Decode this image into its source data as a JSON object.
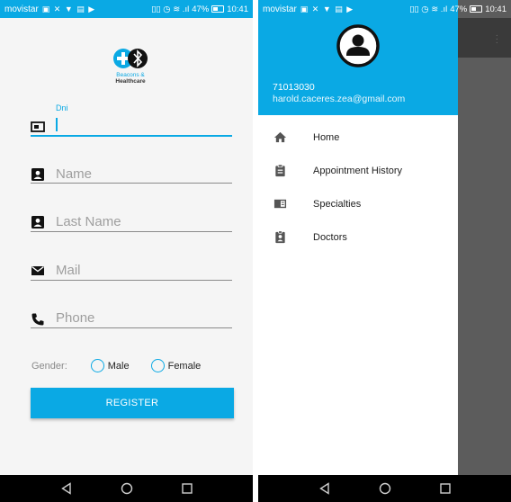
{
  "status_bar": {
    "carrier": "movistar",
    "left_icons": "▣ ✕ ▼ ▤ ▶",
    "right_icons": "▯▯ ◷ ≋ .ıl",
    "battery": "47%",
    "time_left": "10:41",
    "time_right": "10:41"
  },
  "form": {
    "logo_line1": "Beacons &",
    "logo_line2": "Healthcare",
    "dni_label": "Dni",
    "name_placeholder": "Name",
    "last_name_placeholder": "Last Name",
    "mail_placeholder": "Mail",
    "phone_placeholder": "Phone",
    "gender_label": "Gender:",
    "male_label": "Male",
    "female_label": "Female",
    "register_label": "REGISTER"
  },
  "drawer": {
    "user_id": "71013030",
    "user_email": "harold.caceres.zea@gmail.com",
    "items": [
      {
        "label": "Home",
        "icon": "home-icon"
      },
      {
        "label": "Appointment History",
        "icon": "clipboard-icon"
      },
      {
        "label": "Specialties",
        "icon": "book-icon"
      },
      {
        "label": "Doctors",
        "icon": "badge-icon"
      }
    ]
  },
  "colors": {
    "accent": "#0aa9e4",
    "nav_bar": "#000000",
    "scrim": "#5c5c5c"
  }
}
